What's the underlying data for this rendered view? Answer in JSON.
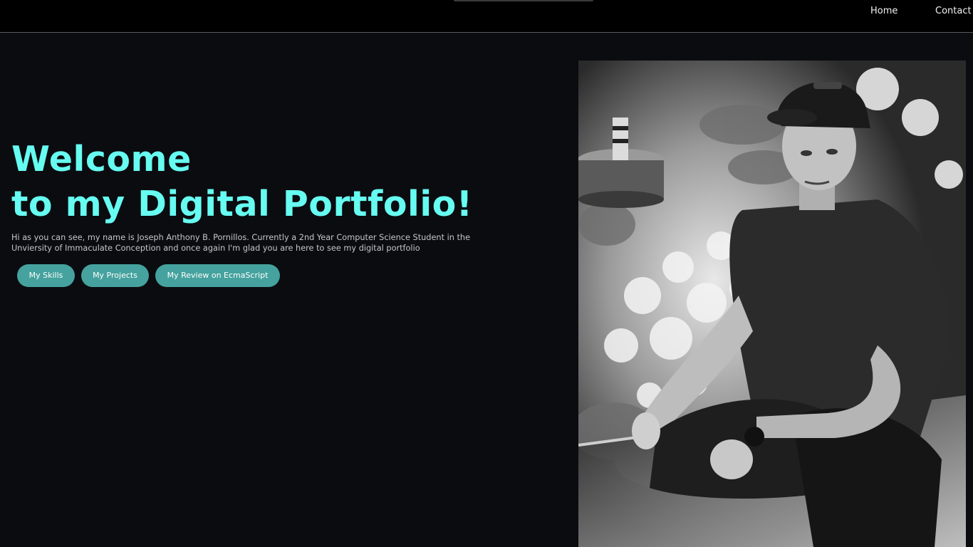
{
  "nav": {
    "home": "Home",
    "contact": "Contact"
  },
  "hero": {
    "title_line1": "Welcome",
    "title_line2": "to my Digital Portfolio!",
    "intro": "Hi as you can see, my name is Joseph Anthony B. Pornillos. Currently a 2nd Year Computer Science Student in the Unviersity of Immaculate Conception and once again I'm glad you are here to see my digital portfolio",
    "buttons": {
      "skills": "My Skills",
      "projects": "My Projects",
      "review": "My Review on EcmaScript"
    }
  },
  "colors": {
    "background": "#0b0c10",
    "accent": "#66fcf1",
    "button": "#45a29e",
    "text": "#c5c6c7"
  },
  "photo": {
    "style": "black-and-white"
  }
}
